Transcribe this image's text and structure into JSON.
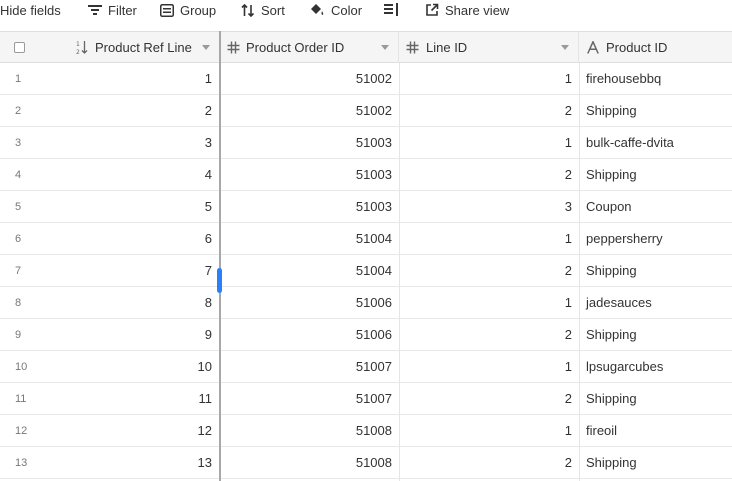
{
  "toolbar": {
    "hide_fields": "Hide fields",
    "filter": "Filter",
    "group": "Group",
    "sort": "Sort",
    "color": "Color",
    "row_height_icon": "row-height-icon",
    "share_view": "Share view"
  },
  "columns": [
    {
      "label": "Product Ref Line",
      "icon": "autonumber-icon"
    },
    {
      "label": "Product Order ID",
      "icon": "number-icon"
    },
    {
      "label": "Line ID",
      "icon": "number-icon"
    },
    {
      "label": "Product ID",
      "icon": "text-icon"
    }
  ],
  "rows": [
    {
      "n": "1",
      "ref": "1",
      "order": "51002",
      "line": "1",
      "product": "firehousebbq"
    },
    {
      "n": "2",
      "ref": "2",
      "order": "51002",
      "line": "2",
      "product": "Shipping"
    },
    {
      "n": "3",
      "ref": "3",
      "order": "51003",
      "line": "1",
      "product": "bulk-caffe-dvita"
    },
    {
      "n": "4",
      "ref": "4",
      "order": "51003",
      "line": "2",
      "product": "Shipping"
    },
    {
      "n": "5",
      "ref": "5",
      "order": "51003",
      "line": "3",
      "product": "Coupon"
    },
    {
      "n": "6",
      "ref": "6",
      "order": "51004",
      "line": "1",
      "product": "peppersherry"
    },
    {
      "n": "7",
      "ref": "7",
      "order": "51004",
      "line": "2",
      "product": "Shipping"
    },
    {
      "n": "8",
      "ref": "8",
      "order": "51006",
      "line": "1",
      "product": "jadesauces"
    },
    {
      "n": "9",
      "ref": "9",
      "order": "51006",
      "line": "2",
      "product": "Shipping"
    },
    {
      "n": "10",
      "ref": "10",
      "order": "51007",
      "line": "1",
      "product": "lpsugarcubes"
    },
    {
      "n": "11",
      "ref": "11",
      "order": "51007",
      "line": "2",
      "product": "Shipping"
    },
    {
      "n": "12",
      "ref": "12",
      "order": "51008",
      "line": "1",
      "product": "fireoil"
    },
    {
      "n": "13",
      "ref": "13",
      "order": "51008",
      "line": "2",
      "product": "Shipping"
    }
  ]
}
